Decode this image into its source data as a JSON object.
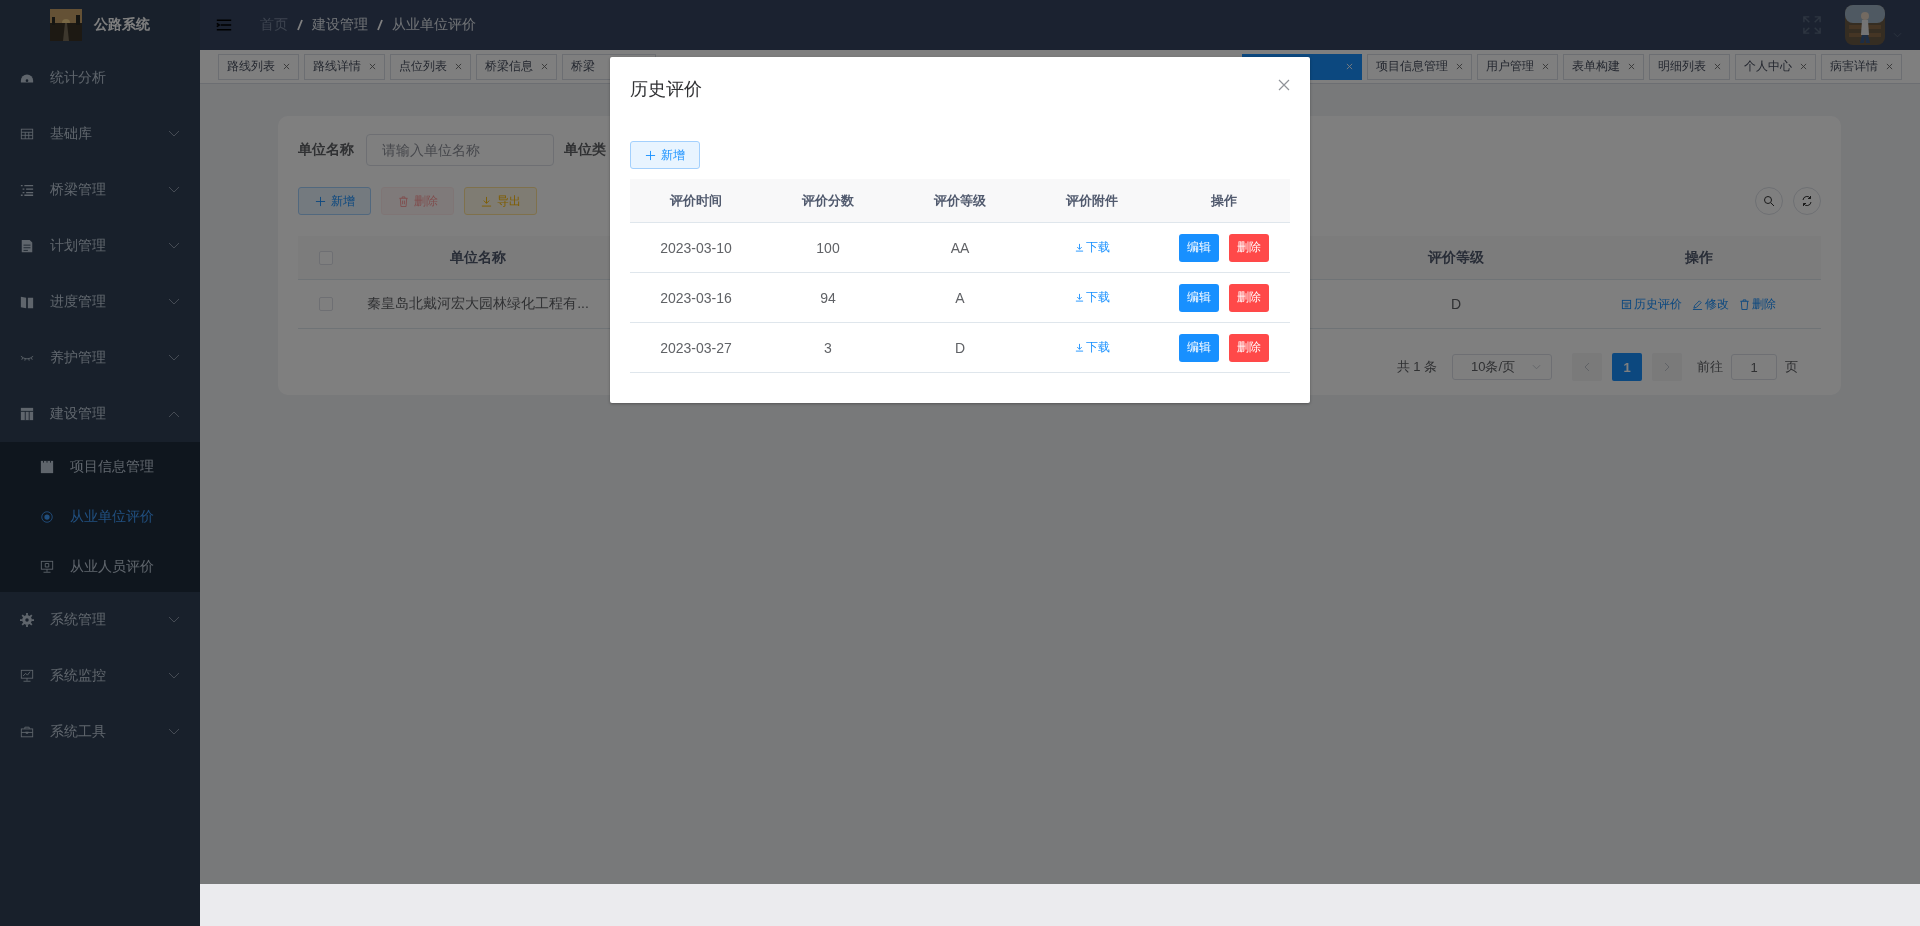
{
  "sidebar": {
    "title": "公路系统",
    "items": [
      {
        "label": "统计分析",
        "kind": "link"
      },
      {
        "label": "基础库",
        "kind": "submenu",
        "expanded": false
      },
      {
        "label": "桥梁管理",
        "kind": "submenu",
        "expanded": false
      },
      {
        "label": "计划管理",
        "kind": "submenu",
        "expanded": false
      },
      {
        "label": "进度管理",
        "kind": "submenu",
        "expanded": false
      },
      {
        "label": "养护管理",
        "kind": "submenu",
        "expanded": false
      },
      {
        "label": "建设管理",
        "kind": "submenu",
        "expanded": true,
        "children": [
          {
            "label": "项目信息管理",
            "selected": false
          },
          {
            "label": "从业单位评价",
            "selected": true
          },
          {
            "label": "从业人员评价",
            "selected": false
          }
        ]
      },
      {
        "label": "系统管理",
        "kind": "submenu",
        "expanded": false
      },
      {
        "label": "系统监控",
        "kind": "submenu",
        "expanded": false
      },
      {
        "label": "系统工具",
        "kind": "submenu",
        "expanded": false
      }
    ]
  },
  "navbar": {
    "breadcrumb": [
      "首页",
      "建设管理",
      "从业单位评价"
    ]
  },
  "tags": [
    {
      "label": "路线列表",
      "selected": false
    },
    {
      "label": "路线详情",
      "selected": false
    },
    {
      "label": "点位列表",
      "selected": false
    },
    {
      "label": "桥梁信息",
      "selected": false
    },
    {
      "label": "桥梁",
      "selected": false
    },
    {
      "selected": true
    },
    {
      "label": "项目信息管理",
      "selected": false
    },
    {
      "label": "用户管理",
      "selected": false
    },
    {
      "label": "表单构建",
      "selected": false
    },
    {
      "label": "明细列表",
      "selected": false
    },
    {
      "label": "个人中心",
      "selected": false
    },
    {
      "label": "病害详情",
      "selected": false
    }
  ],
  "search_form": {
    "fields": [
      {
        "label": "单位名称",
        "placeholder": "请输入单位名称"
      },
      {
        "label": "单位类"
      }
    ]
  },
  "toolbar": {
    "buttons": [
      {
        "label": "新增",
        "kind": "primary",
        "disabled": false
      },
      {
        "label": "删除",
        "kind": "danger",
        "disabled": true
      },
      {
        "label": "导出",
        "kind": "warning",
        "disabled": false
      }
    ]
  },
  "table": {
    "all_checked": false,
    "columns": [
      "单位名称",
      "评价等级",
      "操作"
    ],
    "rows": [
      {
        "checked": false,
        "name": "秦皇岛北戴河宏大园林绿化工程有...",
        "grade": "D",
        "actions": [
          "历史评价",
          "修改",
          "删除"
        ]
      }
    ]
  },
  "pagination": {
    "total": "共 1 条",
    "page_size": "10条/页",
    "pages": [
      {
        "label": "1",
        "selected": true
      }
    ],
    "goto_label": "前往",
    "goto_value": "1",
    "goto_suffix": "页"
  },
  "dialog": {
    "title": "历史评价",
    "add_button": "新增",
    "columns": [
      "评价时间",
      "评价分数",
      "评价等级",
      "评价附件",
      "操作"
    ],
    "rows": [
      {
        "time": "2023-03-10",
        "score": "100",
        "grade": "AA",
        "attachment": "下载",
        "actions": [
          "编辑",
          "删除"
        ]
      },
      {
        "time": "2023-03-16",
        "score": "94",
        "grade": "A",
        "attachment": "下载",
        "actions": [
          "编辑",
          "删除"
        ]
      },
      {
        "time": "2023-03-27",
        "score": "3",
        "grade": "D",
        "attachment": "下载",
        "actions": [
          "编辑",
          "删除"
        ]
      }
    ]
  }
}
